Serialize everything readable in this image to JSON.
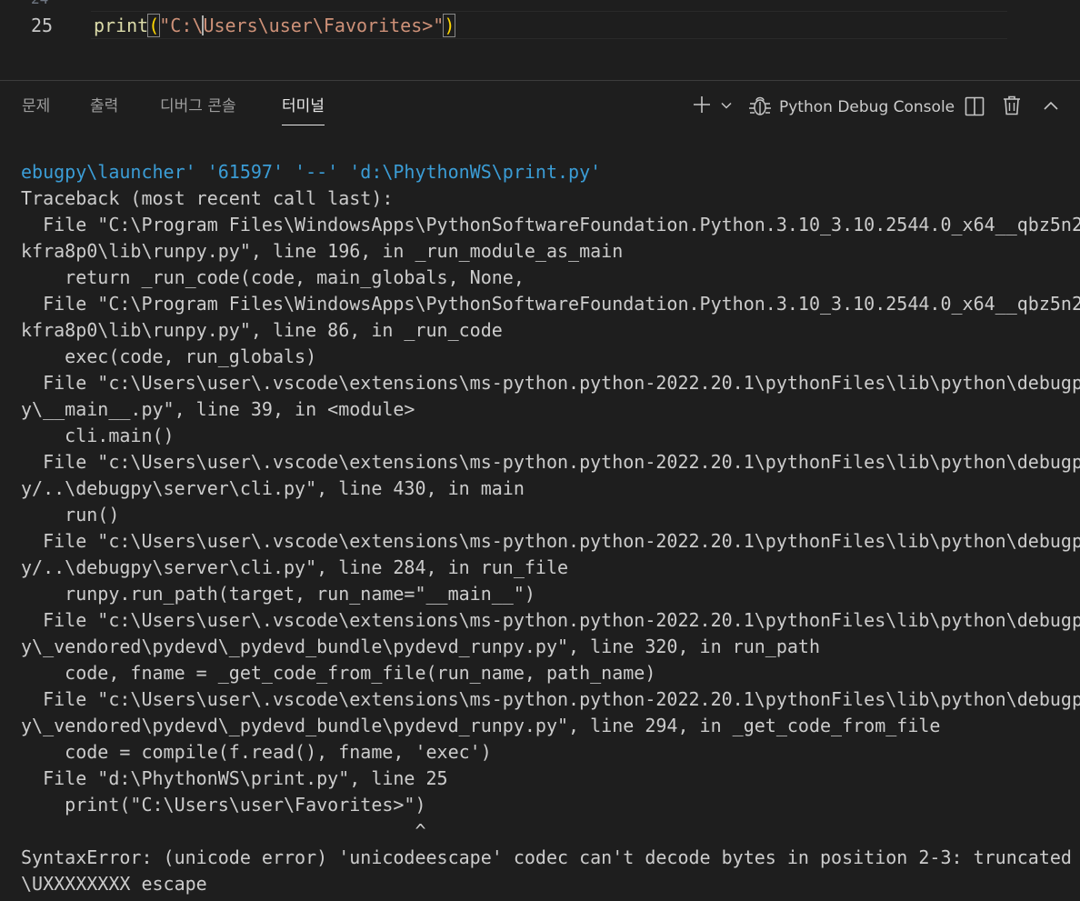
{
  "editor": {
    "prev_line_number": "24",
    "line_number": "25",
    "code": {
      "fn": "print",
      "open_paren": "(",
      "str_before_cursor": "\"C:\\",
      "str_after_cursor": "Users\\user\\Favorites>\"",
      "close_paren": ")"
    }
  },
  "panel": {
    "tabs": [
      {
        "label": "문제"
      },
      {
        "label": "출력"
      },
      {
        "label": "디버그 콘솔"
      },
      {
        "label": "터미널",
        "active": true
      }
    ],
    "toolbar": {
      "new_terminal_icon": "plus-icon",
      "dropdown_icon": "chevron-down-icon",
      "debug_icon": "bug-icon",
      "terminal_name": "Python Debug Console",
      "split_icon": "split-icon",
      "trash_icon": "trash-icon",
      "maximize_icon": "chevron-up-icon"
    }
  },
  "terminal": {
    "command_line": "ebugpy\\launcher' '61597' '--' 'd:\\PhythonWS\\print.py'",
    "lines": [
      "Traceback (most recent call last):",
      "  File \"C:\\Program Files\\WindowsApps\\PythonSoftwareFoundation.Python.3.10_3.10.2544.0_x64__qbz5n2",
      "kfra8p0\\lib\\runpy.py\", line 196, in _run_module_as_main",
      "    return _run_code(code, main_globals, None,",
      "  File \"C:\\Program Files\\WindowsApps\\PythonSoftwareFoundation.Python.3.10_3.10.2544.0_x64__qbz5n2",
      "kfra8p0\\lib\\runpy.py\", line 86, in _run_code",
      "    exec(code, run_globals)",
      "  File \"c:\\Users\\user\\.vscode\\extensions\\ms-python.python-2022.20.1\\pythonFiles\\lib\\python\\debugp",
      "y\\__main__.py\", line 39, in <module>",
      "    cli.main()",
      "  File \"c:\\Users\\user\\.vscode\\extensions\\ms-python.python-2022.20.1\\pythonFiles\\lib\\python\\debugp",
      "y/..\\debugpy\\server\\cli.py\", line 430, in main",
      "    run()",
      "  File \"c:\\Users\\user\\.vscode\\extensions\\ms-python.python-2022.20.1\\pythonFiles\\lib\\python\\debugp",
      "y/..\\debugpy\\server\\cli.py\", line 284, in run_file",
      "    runpy.run_path(target, run_name=\"__main__\")",
      "  File \"c:\\Users\\user\\.vscode\\extensions\\ms-python.python-2022.20.1\\pythonFiles\\lib\\python\\debugp",
      "y\\_vendored\\pydevd\\_pydevd_bundle\\pydevd_runpy.py\", line 320, in run_path",
      "    code, fname = _get_code_from_file(run_name, path_name)",
      "  File \"c:\\Users\\user\\.vscode\\extensions\\ms-python.python-2022.20.1\\pythonFiles\\lib\\python\\debugp",
      "y\\_vendored\\pydevd\\_pydevd_bundle\\pydevd_runpy.py\", line 294, in _get_code_from_file",
      "    code = compile(f.read(), fname, 'exec')",
      "  File \"d:\\PhythonWS\\print.py\", line 25",
      "    print(\"C:\\Users\\user\\Favorites>\")",
      "                                    ^",
      "SyntaxError: (unicode error) 'unicodeescape' codec can't decode bytes in position 2-3: truncated",
      "\\UXXXXXXXX escape"
    ]
  }
}
